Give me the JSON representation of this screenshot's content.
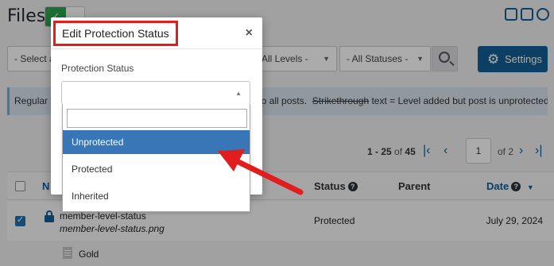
{
  "page": {
    "title": "Files"
  },
  "top_icons": [
    "video-icon",
    "search-doc-icon",
    "help-icon"
  ],
  "filters": {
    "first_select": "- Select a",
    "levels_select": "All Levels -",
    "statuses_select": "- All Statuses -",
    "settings_label": "Settings"
  },
  "notice": {
    "prefix": "Regular t",
    "middle": "o all posts.",
    "strike_word": "Strikethrough",
    "suffix": "text = Level added but post is unprotected."
  },
  "pagination": {
    "range": "1 - 25",
    "of_word": "of",
    "total": "45",
    "current_page": "1",
    "of_pages": "of 2"
  },
  "table": {
    "headers": {
      "name": "N",
      "status": "Status",
      "parent": "Parent",
      "date": "Date"
    },
    "rows": [
      {
        "name": "member-level-status",
        "filename": "member-level-status.png",
        "status": "Protected",
        "date": "July 29, 2024",
        "checked": true
      }
    ],
    "child_row": {
      "name": "Gold"
    }
  },
  "modal": {
    "title": "Edit Protection Status",
    "close": "×",
    "field_label": "Protection Status",
    "search_value": "",
    "options": [
      "Unprotected",
      "Protected",
      "Inherited"
    ],
    "highlighted_option": "Unprotected"
  },
  "colors": {
    "accent": "#135e96",
    "highlight_border": "#e11d1d",
    "option_active": "#3876b8",
    "toggle_on": "#2ea44f"
  }
}
